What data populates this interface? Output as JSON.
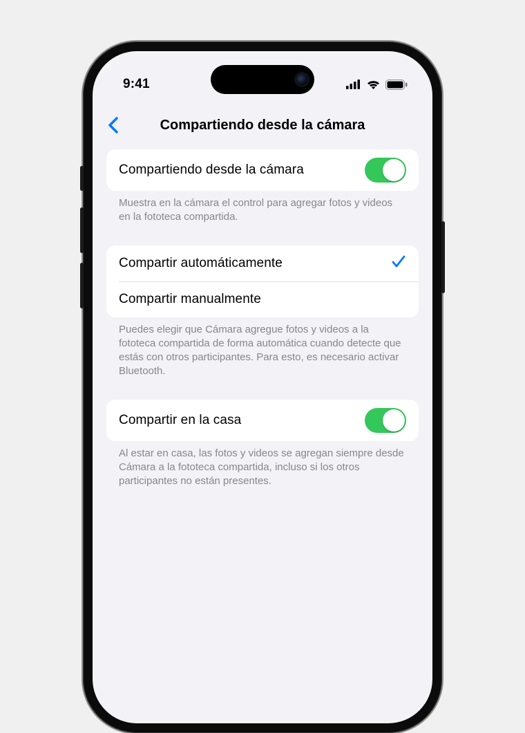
{
  "status": {
    "time": "9:41"
  },
  "nav": {
    "title": "Compartiendo desde la cámara"
  },
  "group1": {
    "toggle_label": "Compartiendo desde la cámara",
    "toggle_on": true,
    "footer": "Muestra en la cámara el control para agregar fotos y videos en la fototeca compartida."
  },
  "group2": {
    "option_auto": "Compartir automáticamente",
    "option_manual": "Compartir manualmente",
    "selected": "auto",
    "footer": "Puedes elegir que Cámara agregue fotos y videos a la fototeca compartida de forma automática cuando detecte que estás con otros participantes. Para esto, es necesario activar Bluetooth."
  },
  "group3": {
    "toggle_label": "Compartir en la casa",
    "toggle_on": true,
    "footer": "Al estar en casa, las fotos y videos se agregan siempre desde Cámara a la fototeca compartida, incluso si los otros participantes no están presentes."
  },
  "colors": {
    "accent": "#007aff",
    "toggle_on": "#34c759",
    "background": "#f2f2f7"
  }
}
